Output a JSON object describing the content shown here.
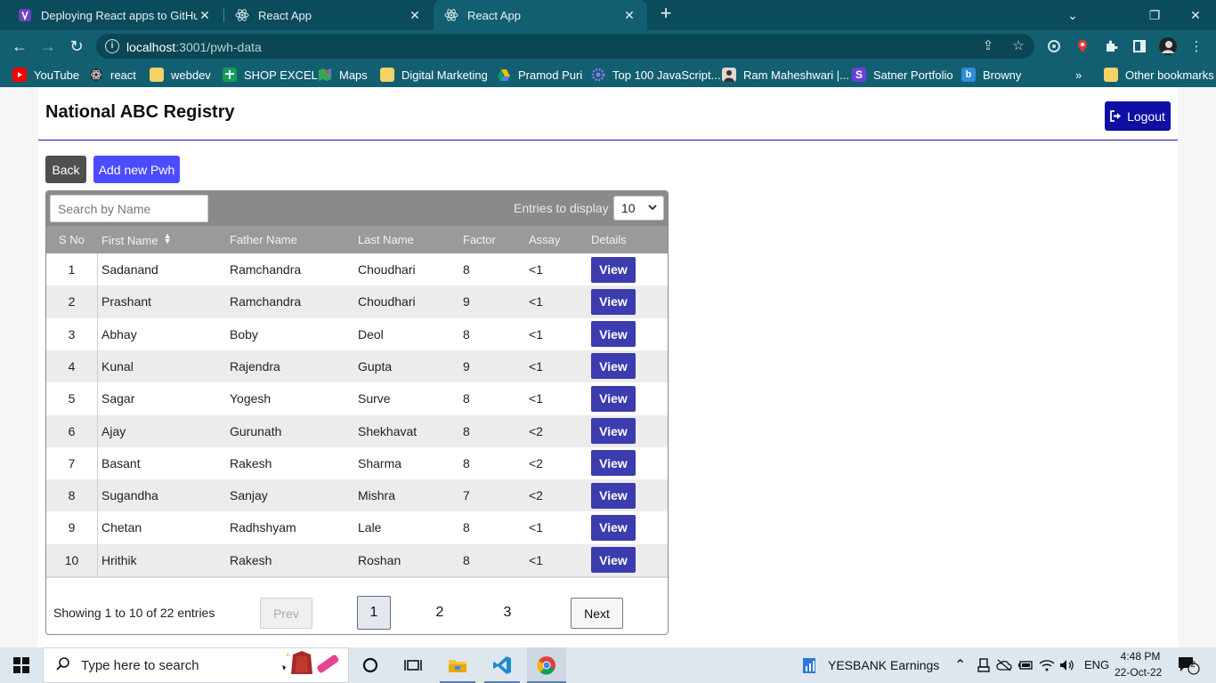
{
  "browser": {
    "tabs": [
      {
        "title": "Deploying React apps to GitHub",
        "icon": "vite-icon",
        "active": false
      },
      {
        "title": "React App",
        "icon": "react-icon",
        "active": false
      },
      {
        "title": "React App",
        "icon": "react-icon",
        "active": true
      }
    ],
    "new_tab": "+",
    "url_host": "localhost",
    "url_rest": ":3001/pwh-data",
    "bookmarks": [
      {
        "label": "YouTube",
        "icon": "youtube-icon"
      },
      {
        "label": "react",
        "icon": "react-icon"
      },
      {
        "label": "webdev",
        "icon": "folder-icon"
      },
      {
        "label": "SHOP EXCEL",
        "icon": "excel-icon"
      },
      {
        "label": "Maps",
        "icon": "maps-icon"
      },
      {
        "label": "Digital Marketing",
        "icon": "folder-icon"
      },
      {
        "label": "Pramod Puri",
        "icon": "drive-icon"
      },
      {
        "label": "Top 100 JavaScript...",
        "icon": "gear-icon"
      },
      {
        "label": "Ram Maheshwari |...",
        "icon": "avatar-icon"
      },
      {
        "label": "Satner Portfolio",
        "icon": "s-logo-icon"
      },
      {
        "label": "Browny",
        "icon": "browny-icon"
      }
    ],
    "more_bookmarks": "»",
    "other_bookmarks": "Other bookmarks"
  },
  "app": {
    "title": "National ABC Registry",
    "logout_label": "Logout",
    "back_label": "Back",
    "add_label": "Add new Pwh",
    "search_placeholder": "Search by Name",
    "entries_label": "Entries to display",
    "entries_value": "10",
    "columns": [
      "S No",
      "First Name",
      "Father Name",
      "Last Name",
      "Factor",
      "Assay",
      "Details"
    ],
    "rows": [
      {
        "sno": "1",
        "first": "Sadanand",
        "father": "Ramchandra",
        "last": "Choudhari",
        "factor": "8",
        "assay": "<1",
        "action": "View"
      },
      {
        "sno": "2",
        "first": "Prashant",
        "father": "Ramchandra",
        "last": "Choudhari",
        "factor": "9",
        "assay": "<1",
        "action": "View"
      },
      {
        "sno": "3",
        "first": "Abhay",
        "father": "Boby",
        "last": "Deol",
        "factor": "8",
        "assay": "<1",
        "action": "View"
      },
      {
        "sno": "4",
        "first": "Kunal",
        "father": "Rajendra",
        "last": "Gupta",
        "factor": "9",
        "assay": "<1",
        "action": "View"
      },
      {
        "sno": "5",
        "first": "Sagar",
        "father": "Yogesh",
        "last": "Surve",
        "factor": "8",
        "assay": "<1",
        "action": "View"
      },
      {
        "sno": "6",
        "first": "Ajay",
        "father": "Gurunath",
        "last": "Shekhavat",
        "factor": "8",
        "assay": "<2",
        "action": "View"
      },
      {
        "sno": "7",
        "first": "Basant",
        "father": "Rakesh",
        "last": "Sharma",
        "factor": "8",
        "assay": "<2",
        "action": "View"
      },
      {
        "sno": "8",
        "first": "Sugandha",
        "father": "Sanjay",
        "last": "Mishra",
        "factor": "7",
        "assay": "<2",
        "action": "View"
      },
      {
        "sno": "9",
        "first": "Chetan",
        "father": "Radhshyam",
        "last": "Lale",
        "factor": "8",
        "assay": "<1",
        "action": "View"
      },
      {
        "sno": "10",
        "first": "Hrithik",
        "father": "Rakesh",
        "last": "Roshan",
        "factor": "8",
        "assay": "<1",
        "action": "View"
      }
    ],
    "showing_text": "Showing 1 to 10 of 22 entries",
    "prev_label": "Prev",
    "next_label": "Next",
    "pages": [
      "1",
      "2",
      "3"
    ],
    "current_page": "1"
  },
  "taskbar": {
    "search_placeholder": "Type here to search",
    "stock_text": "YESBANK  Earnings",
    "language": "ENG",
    "time": "4:48 PM",
    "date": "22-Oct-22",
    "notification_count": "2"
  },
  "colors": {
    "tab_bar": "#0a4b5c",
    "toolbar": "#135f72",
    "primary_button": "#4c4cff",
    "view_button": "#3c3caf",
    "logout_button": "#0f0fa3",
    "header_gray": "#8a8a8a"
  }
}
